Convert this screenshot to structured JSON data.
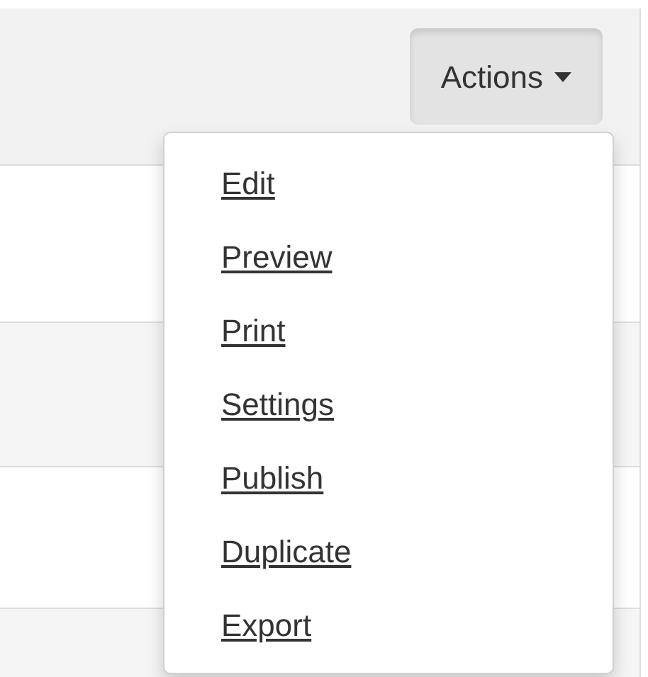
{
  "actions_button": {
    "label": "Actions",
    "expanded": true
  },
  "dropdown_menu": {
    "items": [
      {
        "label": "Edit"
      },
      {
        "label": "Preview"
      },
      {
        "label": "Print"
      },
      {
        "label": "Settings"
      },
      {
        "label": "Publish"
      },
      {
        "label": "Duplicate"
      },
      {
        "label": "Export"
      }
    ]
  }
}
